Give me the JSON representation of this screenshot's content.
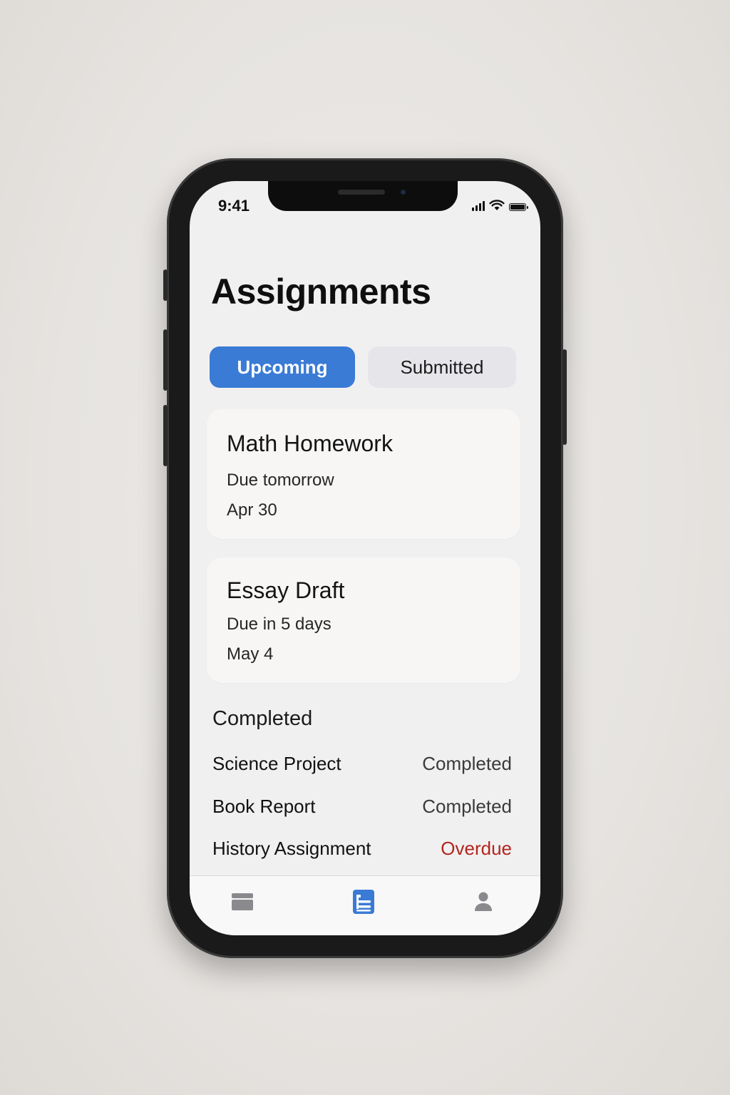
{
  "status_bar": {
    "time": "9:41"
  },
  "header": {
    "title": "Assignments"
  },
  "segmented_control": {
    "active_label": "Upcoming",
    "inactive_label": "Submitted"
  },
  "upcoming": [
    {
      "title": "Math Homework",
      "due_text": "Due tomorrow",
      "date": "Apr 30"
    },
    {
      "title": "Essay Draft",
      "due_text": "Due in 5 days",
      "date": "May 4"
    }
  ],
  "completed_section": {
    "heading": "Completed",
    "rows": [
      {
        "name": "Science Project",
        "status": "Completed"
      },
      {
        "name": "Book Report",
        "status": "Completed"
      },
      {
        "name": "History Assignment",
        "status": "Overdue"
      }
    ]
  },
  "tab_bar": {
    "tabs": [
      {
        "icon": "courses-icon",
        "active": false
      },
      {
        "icon": "assignments-icon",
        "active": true
      },
      {
        "icon": "profile-icon",
        "active": false
      }
    ]
  },
  "colors": {
    "accent": "#3a7bd5",
    "overdue": "#b3261e",
    "inactive_icon": "#8a8a8e"
  }
}
